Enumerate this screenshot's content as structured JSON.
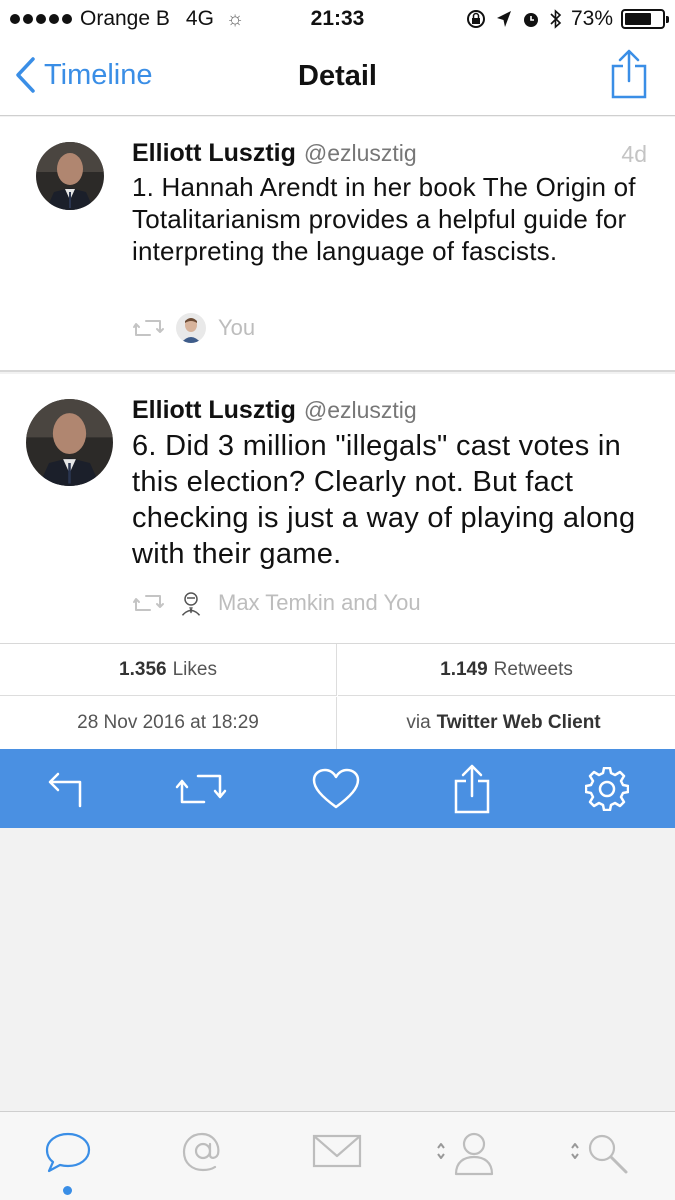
{
  "status_bar": {
    "carrier": "Orange B",
    "network": "4G",
    "time": "21:33",
    "battery": "73%",
    "battery_level": 0.73
  },
  "nav": {
    "back_label": "Timeline",
    "title": "Detail"
  },
  "tweets": [
    {
      "name": "Elliott Lusztig",
      "handle": "@ezlusztig",
      "time": "4d",
      "text": "1. Hannah Arendt in her book The Origin of Totalitarianism provides a helpful guide for interpreting the language of fascists.",
      "retweeted_by": "You"
    },
    {
      "name": "Elliott Lusztig",
      "handle": "@ezlusztig",
      "text": "6. Did 3 million \"illegals\" cast votes in this election? Clearly not. But fact checking is just a way of playing along with their game.",
      "retweeted_by": "Max Temkin and You"
    }
  ],
  "stats": {
    "likes_count": "1.356",
    "likes_label": "Likes",
    "retweets_count": "1.149",
    "retweets_label": "Retweets",
    "date": "28 Nov 2016 at 18:29",
    "via_prefix": "via",
    "client": "Twitter Web Client"
  },
  "action_bar": {
    "icons": [
      "reply-icon",
      "retweet-icon",
      "like-icon",
      "share-icon",
      "settings-icon"
    ],
    "color": "#4a90e2"
  },
  "tab_bar": {
    "icons": [
      "timeline-bubble-icon",
      "mentions-at-icon",
      "messages-envelope-icon",
      "profile-icon",
      "search-icon"
    ],
    "active_index": 0,
    "accent": "#3a8ee6"
  }
}
